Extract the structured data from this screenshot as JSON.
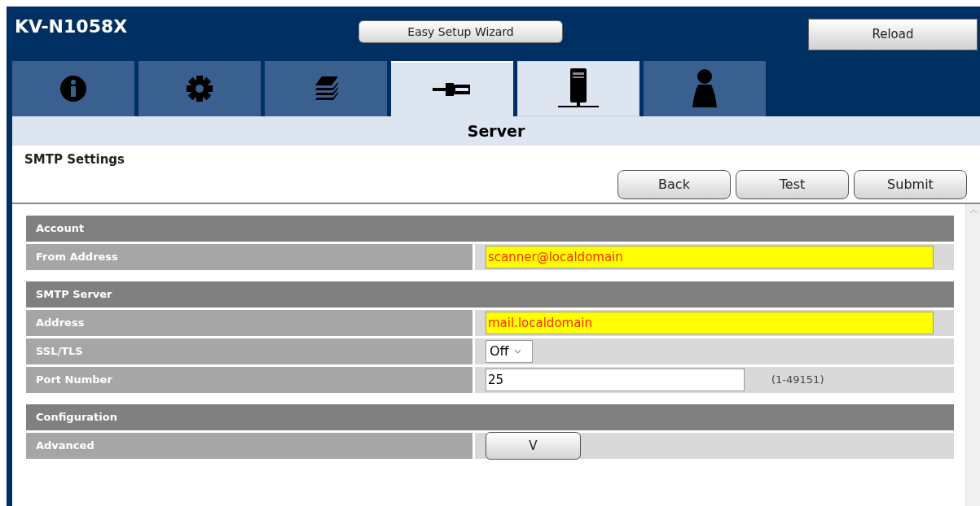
{
  "header": {
    "title": "KV-N1058X",
    "wizard_button": "Easy Setup Wizard",
    "reload_button": "Reload"
  },
  "tabs": [
    {
      "kind": "info",
      "selected": false,
      "hovered": false
    },
    {
      "kind": "gear",
      "selected": false,
      "hovered": false
    },
    {
      "kind": "stack",
      "selected": false,
      "hovered": false
    },
    {
      "kind": "plug",
      "selected": true,
      "hovered": false
    },
    {
      "kind": "server",
      "selected": false,
      "hovered": true
    },
    {
      "kind": "person",
      "selected": false,
      "hovered": false
    }
  ],
  "page_title": "Server",
  "section_title": "SMTP Settings",
  "actions": [
    "Back",
    "Test",
    "Submit"
  ],
  "groups": [
    {
      "title": "Account",
      "rows": [
        {
          "label": "From Address",
          "kind": "text",
          "value": "scanner@localdomain",
          "highlighted": true
        }
      ]
    },
    {
      "title": "SMTP Server",
      "rows": [
        {
          "label": "Address",
          "kind": "text",
          "value": "mail.localdomain",
          "highlighted": true
        },
        {
          "label": "SSL/TLS",
          "kind": "select",
          "value": "Off"
        },
        {
          "label": "Port Number",
          "kind": "number",
          "value": "25",
          "highlighted": false,
          "hint": "(1-49151)"
        }
      ]
    },
    {
      "title": "Configuration",
      "rows": [
        {
          "label": "Advanced",
          "kind": "toggle",
          "value": "V"
        }
      ]
    }
  ]
}
